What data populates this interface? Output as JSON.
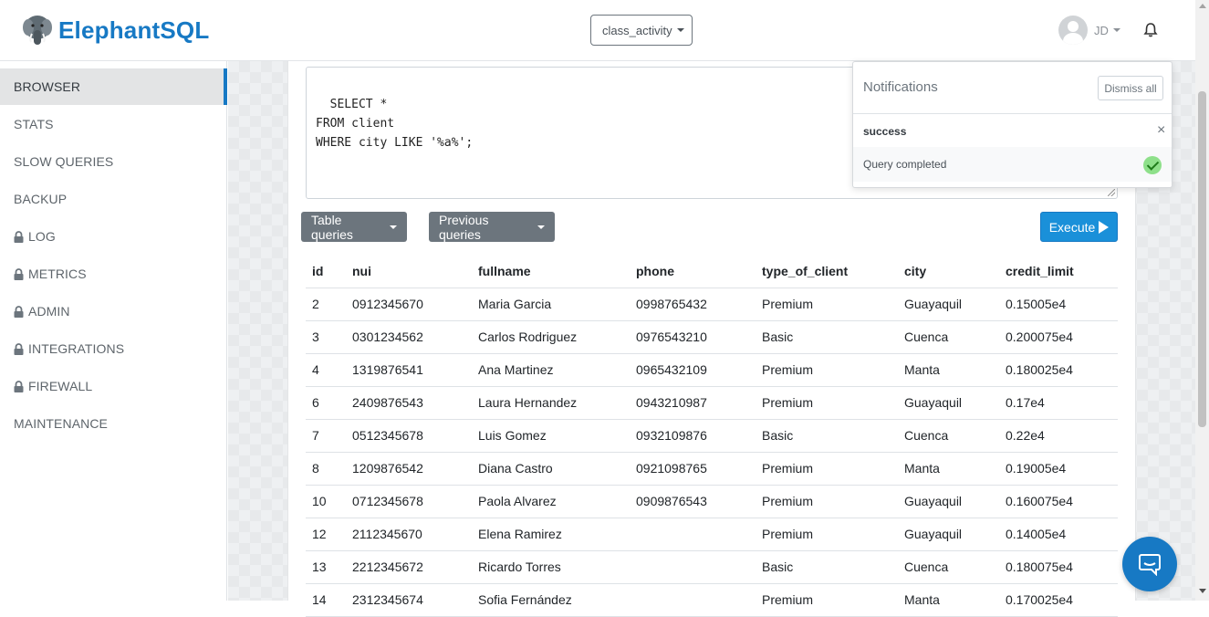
{
  "brand": {
    "name": "ElephantSQL",
    "color": "#1779c4"
  },
  "header": {
    "instance_selected": "class_activity",
    "user_initials": "JD"
  },
  "sidebar": {
    "items": [
      {
        "label": "BROWSER",
        "locked": false,
        "active": true
      },
      {
        "label": "STATS",
        "locked": false,
        "active": false
      },
      {
        "label": "SLOW QUERIES",
        "locked": false,
        "active": false
      },
      {
        "label": "BACKUP",
        "locked": false,
        "active": false
      },
      {
        "label": "LOG",
        "locked": true,
        "active": false
      },
      {
        "label": "METRICS",
        "locked": true,
        "active": false
      },
      {
        "label": "ADMIN",
        "locked": true,
        "active": false
      },
      {
        "label": "INTEGRATIONS",
        "locked": true,
        "active": false
      },
      {
        "label": "FIREWALL",
        "locked": true,
        "active": false
      },
      {
        "label": "MAINTENANCE",
        "locked": false,
        "active": false
      }
    ]
  },
  "query": {
    "text": "SELECT *\nFROM client\nWHERE city LIKE '%a%';"
  },
  "toolbar": {
    "table_queries_label": "Table queries",
    "previous_queries_label": "Previous queries",
    "execute_label": "Execute"
  },
  "results": {
    "columns": [
      "id",
      "nui",
      "fullname",
      "phone",
      "type_of_client",
      "city",
      "credit_limit"
    ],
    "rows": [
      [
        "2",
        "0912345670",
        "Maria Garcia",
        "0998765432",
        "Premium",
        "Guayaquil",
        "0.15005e4"
      ],
      [
        "3",
        "0301234562",
        "Carlos Rodriguez",
        "0976543210",
        "Basic",
        "Cuenca",
        "0.200075e4"
      ],
      [
        "4",
        "1319876541",
        "Ana Martinez",
        "0965432109",
        "Premium",
        "Manta",
        "0.180025e4"
      ],
      [
        "6",
        "2409876543",
        "Laura Hernandez",
        "0943210987",
        "Premium",
        "Guayaquil",
        "0.17e4"
      ],
      [
        "7",
        "0512345678",
        "Luis Gomez",
        "0932109876",
        "Basic",
        "Cuenca",
        "0.22e4"
      ],
      [
        "8",
        "1209876542",
        "Diana Castro",
        "0921098765",
        "Premium",
        "Manta",
        "0.19005e4"
      ],
      [
        "10",
        "0712345678",
        "Paola Alvarez",
        "0909876543",
        "Premium",
        "Guayaquil",
        "0.160075e4"
      ],
      [
        "12",
        "2112345670",
        "Elena Ramirez",
        "",
        "Premium",
        "Guayaquil",
        "0.14005e4"
      ],
      [
        "13",
        "2212345672",
        "Ricardo Torres",
        "",
        "Basic",
        "Cuenca",
        "0.180075e4"
      ],
      [
        "14",
        "2312345674",
        "Sofia Fernández",
        "",
        "Premium",
        "Manta",
        "0.170025e4"
      ]
    ]
  },
  "notifications": {
    "title": "Notifications",
    "dismiss_label": "Dismiss all",
    "items": [
      {
        "type": "success",
        "message": "Query completed",
        "status_color": "#8ee08a"
      }
    ]
  },
  "icons": [
    "elephant-logo-icon",
    "user-avatar-icon",
    "bell-icon",
    "lock-icon",
    "play-icon",
    "close-icon",
    "check-icon",
    "chat-icon"
  ]
}
